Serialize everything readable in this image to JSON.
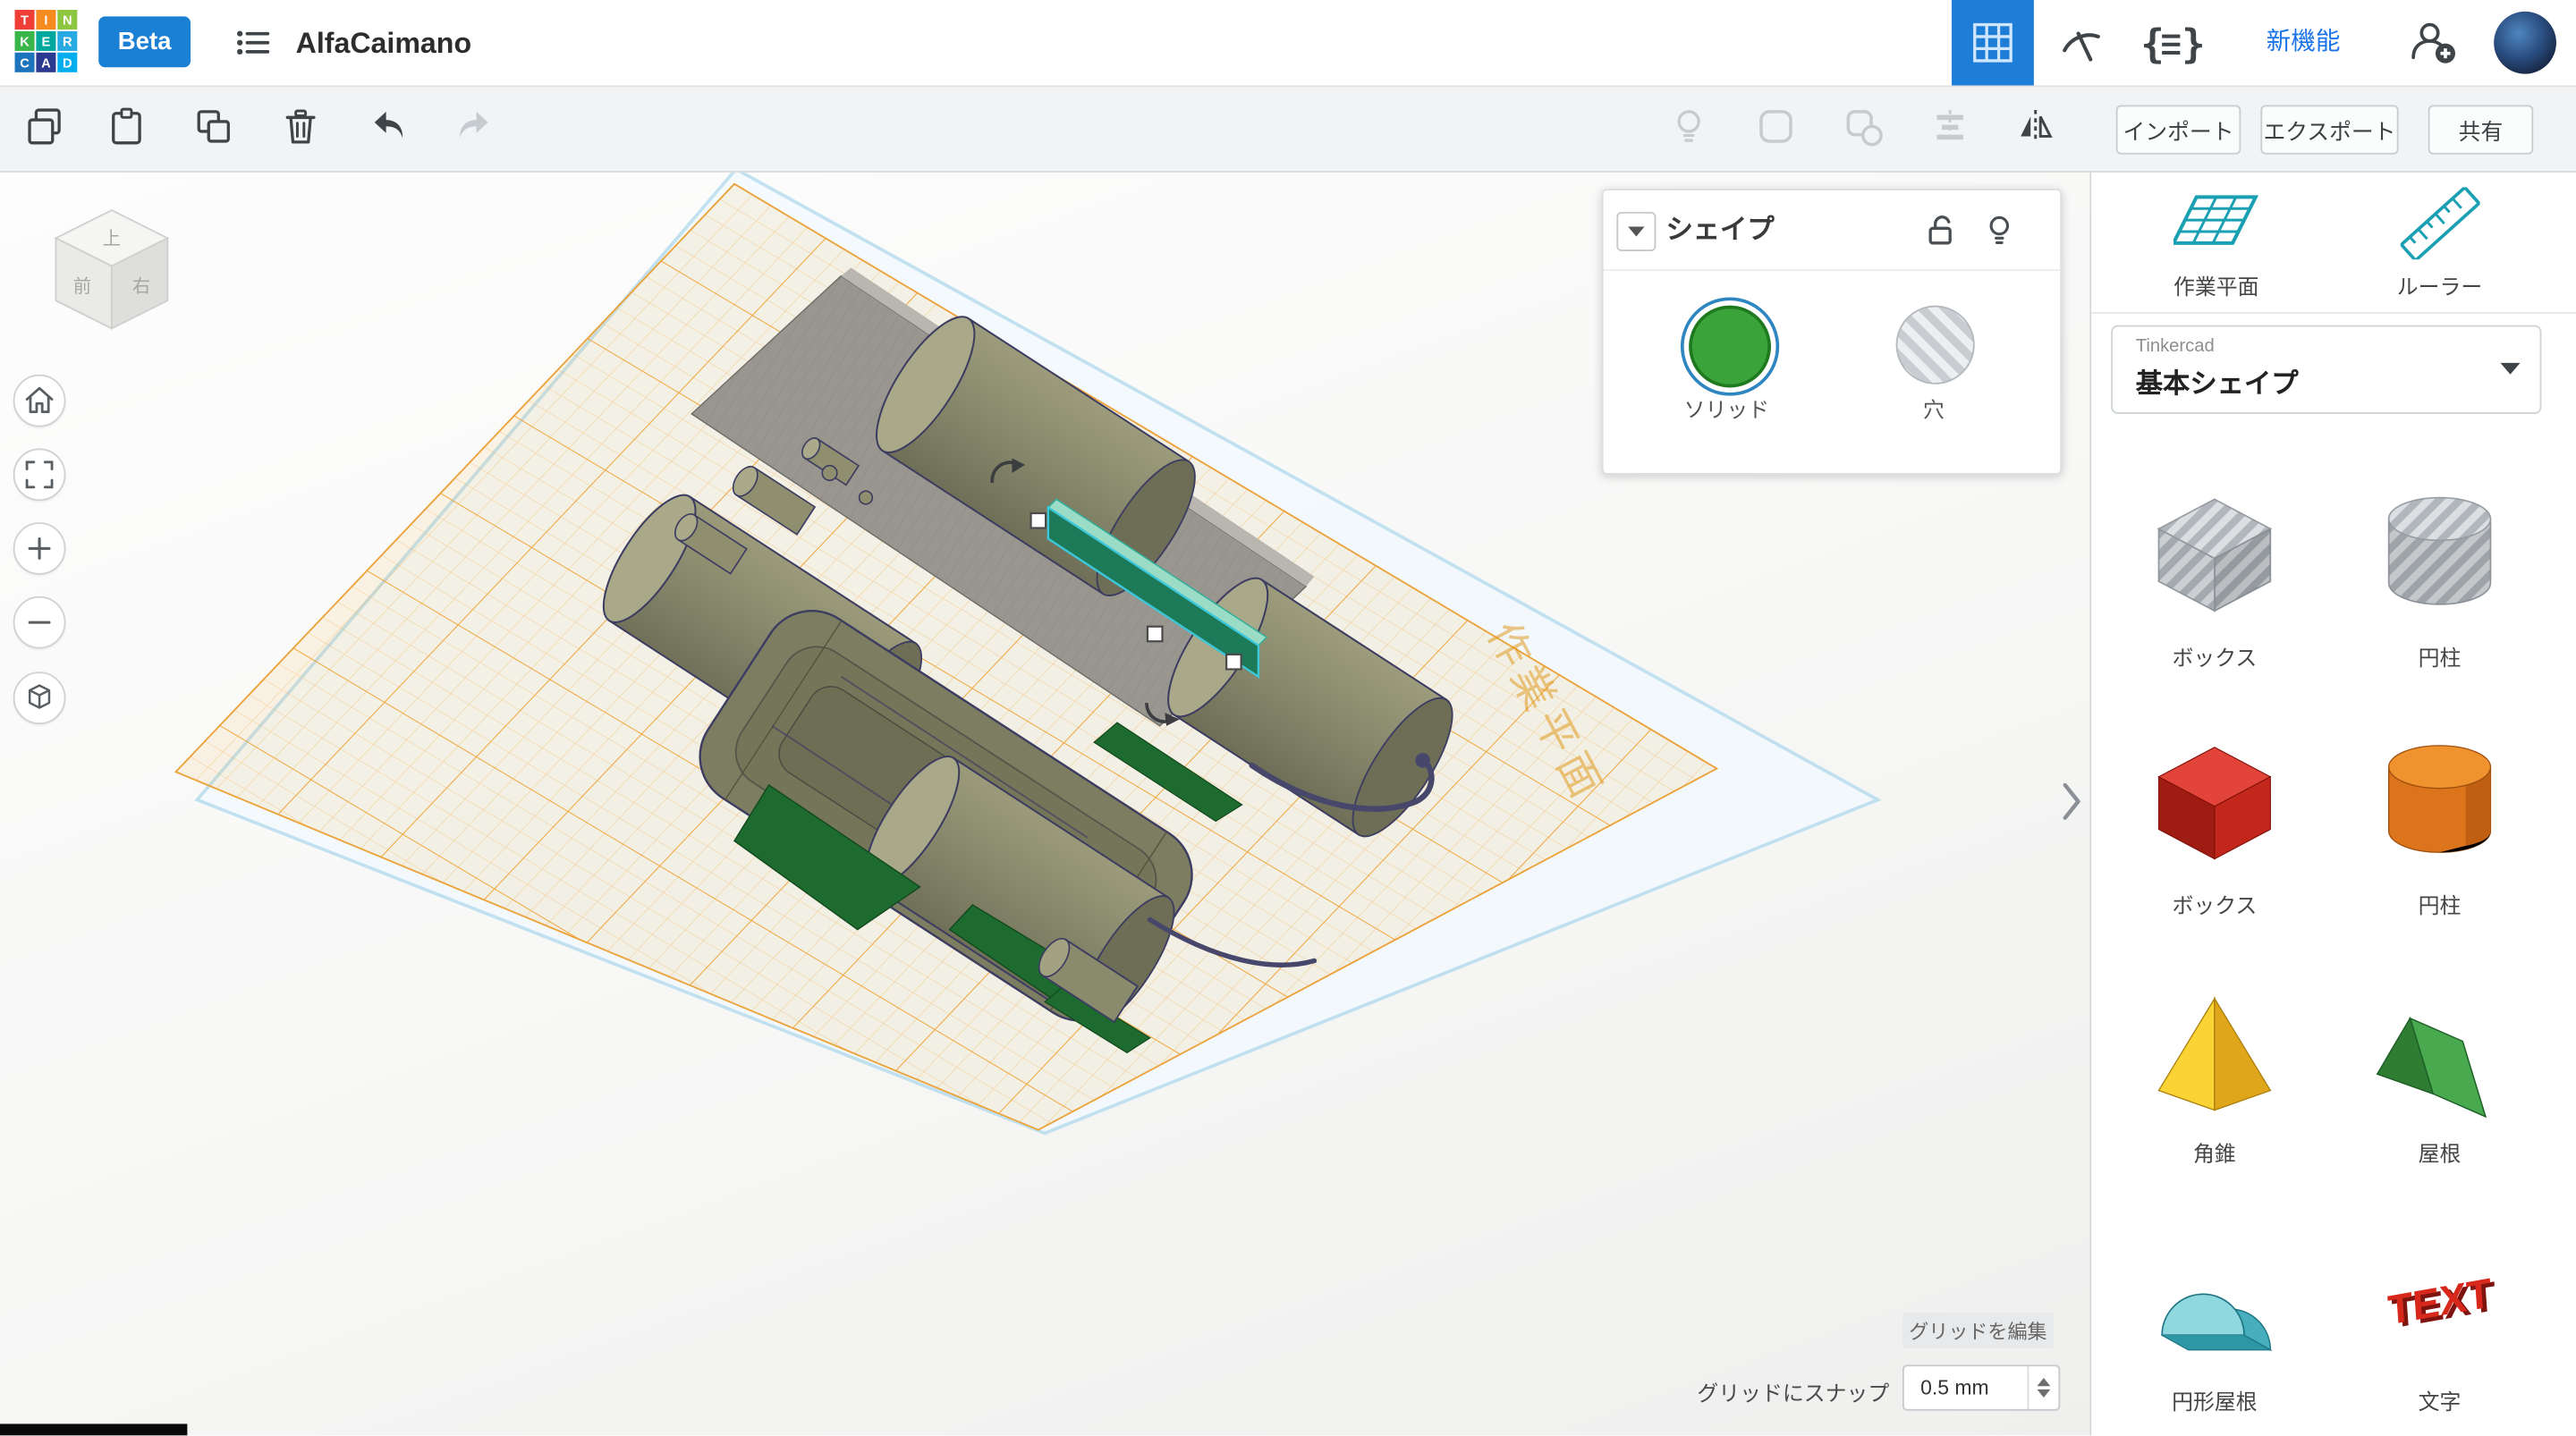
{
  "header": {
    "logo_letters": [
      "T",
      "I",
      "N",
      "K",
      "E",
      "R",
      "C",
      "A",
      "D"
    ],
    "beta_label": "Beta",
    "title": "AlfaCaimano",
    "new_features_label": "新機能"
  },
  "toolbar": {
    "import_label": "インポート",
    "export_label": "エクスポート",
    "share_label": "共有"
  },
  "shape_panel": {
    "title": "シェイプ",
    "solid_label": "ソリッド",
    "hole_label": "穴"
  },
  "viewcube": {
    "top": "上",
    "front": "前",
    "right": "右"
  },
  "canvas": {
    "watermark": "作業平面",
    "edit_grid_label": "グリッドを編集",
    "snap_label": "グリッドにスナップ",
    "snap_value": "0.5 mm"
  },
  "sidebar": {
    "workplane_label": "作業平面",
    "ruler_label": "ルーラー",
    "library_brand": "Tinkercad",
    "library_selected": "基本シェイプ",
    "text_glyph": "TEXT",
    "shapes": [
      {
        "label": "ボックス"
      },
      {
        "label": "円柱"
      },
      {
        "label": "ボックス"
      },
      {
        "label": "円柱"
      },
      {
        "label": "角錐"
      },
      {
        "label": "屋根"
      },
      {
        "label": "円形屋根"
      },
      {
        "label": "文字"
      }
    ]
  },
  "colors": {
    "brand_blue": "#1b7fd4",
    "link_blue": "#1a73e8",
    "tinkercad_teal": "#1aa0b2",
    "workplane_orange": "#f7a41d",
    "solid_green": "#3aa33a",
    "shape_red": "#c3271b",
    "shape_orange": "#e07a1f",
    "shape_yellow": "#fbd334",
    "shape_green": "#49a94f",
    "shape_teal": "#46aebd",
    "model_olive": "#85856a",
    "selection_cyan": "#3cc8da"
  }
}
